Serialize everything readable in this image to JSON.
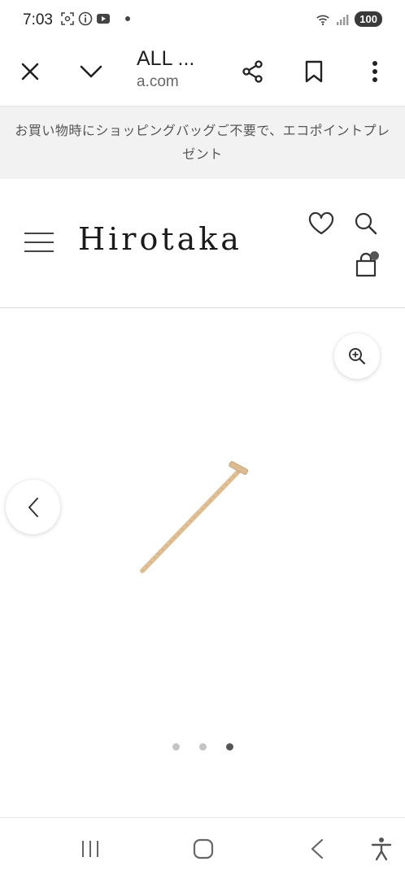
{
  "status_bar": {
    "time": "7:03",
    "battery": "100",
    "icons": [
      "screenshot-icon",
      "info-icon",
      "youtube-icon",
      "notification-dot",
      "wifi-icon",
      "signal-icon"
    ]
  },
  "browser": {
    "page_title": "ALL ...",
    "domain": "a.com",
    "icons": [
      "close-icon",
      "chevron-down-icon",
      "share-icon",
      "bookmark-icon",
      "more-vert-icon"
    ]
  },
  "banner": {
    "text": "お買い物時にショッピングバッグご不要で、エコポイントプレゼント"
  },
  "site_header": {
    "logo": "Hirotaka",
    "icons": [
      "menu-icon",
      "heart-icon",
      "search-icon",
      "shopping-bag-icon"
    ]
  },
  "gallery": {
    "slide_count": 3,
    "active_slide": 3,
    "icons": [
      "zoom-in-icon",
      "chevron-left-icon"
    ],
    "image": "gold-bar-earring"
  },
  "nav_bar": {
    "icons": [
      "recent-apps-icon",
      "home-icon",
      "back-icon",
      "accessibility-icon"
    ]
  },
  "colors": {
    "banner_bg": "#f2f2f2",
    "text_dark": "#222222",
    "muted": "#666666",
    "gold": "#e3c59c"
  }
}
